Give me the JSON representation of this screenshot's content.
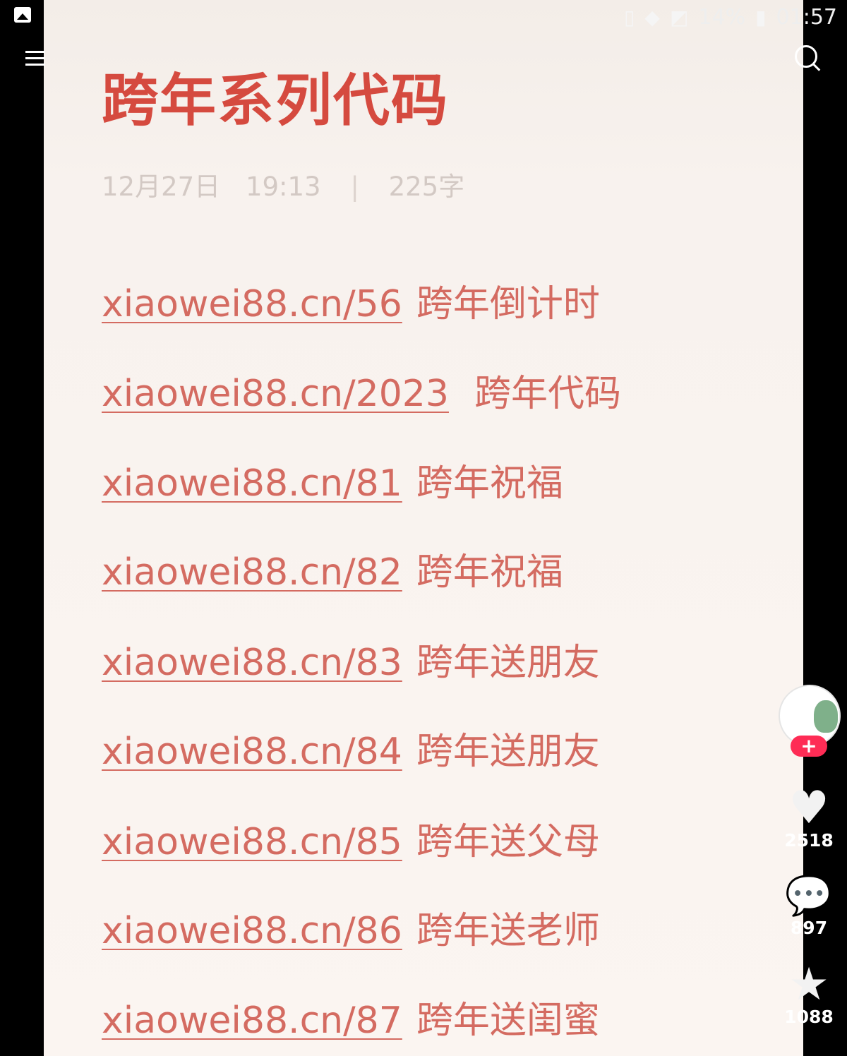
{
  "status_bar": {
    "battery": "14%",
    "time": "01:57"
  },
  "note": {
    "title": "跨年系列代码",
    "date": "12月27日",
    "time": "19:13",
    "separator": "|",
    "word_count": "225字",
    "entries": [
      {
        "link": "xiaowei88.cn/56",
        "desc": "跨年倒计时"
      },
      {
        "link": "xiaowei88.cn/2023",
        "desc": "跨年代码"
      },
      {
        "link": "xiaowei88.cn/81",
        "desc": "跨年祝福"
      },
      {
        "link": "xiaowei88.cn/82",
        "desc": "跨年祝福"
      },
      {
        "link": "xiaowei88.cn/83",
        "desc": "跨年送朋友"
      },
      {
        "link": "xiaowei88.cn/84",
        "desc": "跨年送朋友"
      },
      {
        "link": "xiaowei88.cn/85",
        "desc": "跨年送父母"
      },
      {
        "link": "xiaowei88.cn/86",
        "desc": "跨年送老师"
      },
      {
        "link": "xiaowei88.cn/87",
        "desc": "跨年送闺蜜"
      }
    ]
  },
  "side_actions": {
    "follow_label": "+",
    "likes": "2518",
    "comments": "897",
    "favorites": "1088"
  },
  "icons": {
    "like": "heart-icon",
    "comment": "comment-icon",
    "favorite": "star-icon",
    "menu": "menu-icon",
    "search": "search-icon"
  },
  "colors": {
    "title": "#d54a3f",
    "link": "#d46b61",
    "meta": "#d3c9c4",
    "follow": "#fe2c55"
  }
}
